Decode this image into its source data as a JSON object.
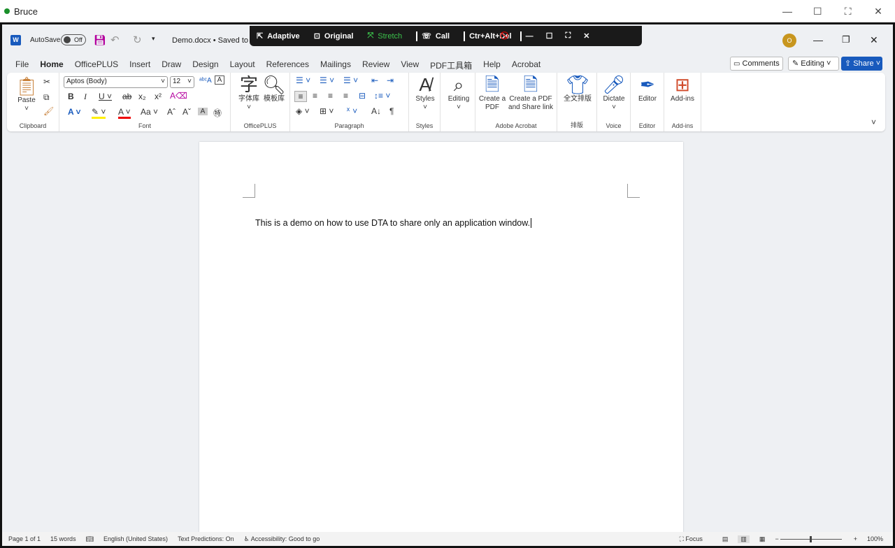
{
  "outer": {
    "user": "Bruce",
    "status_color": "#1a8f2a"
  },
  "toolbar": {
    "adaptive": "Adaptive",
    "original": "Original",
    "stretch": "Stretch",
    "call": "Call",
    "cad": "Ctr+Alt+Del",
    "stretch_color": "#3cc34c"
  },
  "word": {
    "autosave": "AutoSave",
    "autosave_state": "Off",
    "doc_title": "Demo.docx • Saved to t",
    "avatar": "O",
    "tabs": [
      "File",
      "Home",
      "OfficePLUS",
      "Insert",
      "Draw",
      "Design",
      "Layout",
      "References",
      "Mailings",
      "Review",
      "View",
      "PDF工具箱",
      "Help",
      "Acrobat"
    ],
    "comments": "Comments",
    "editing": "Editing",
    "share": "Share",
    "accent": "#185abd"
  },
  "ribbon": {
    "paste": "Paste",
    "font_name": "Aptos (Body)",
    "font_size": "12",
    "groups": [
      "Clipboard",
      "Font",
      "OfficePLUS",
      "Paragraph",
      "Styles",
      "Adobe Acrobat",
      "排版",
      "Voice",
      "Editor",
      "Add-ins"
    ],
    "ziti": "字体库",
    "muban": "模板库",
    "styles": "Styles",
    "editing": "Editing",
    "create_pdf": "Create a PDF",
    "create_share": "Create a PDF and Share link",
    "quanwen": "全文排版",
    "dictate": "Dictate",
    "editor": "Editor",
    "addins": "Add-ins"
  },
  "document": {
    "text": "This is a demo on how to use DTA to share only an application window."
  },
  "status": {
    "page": "Page 1 of 1",
    "words": "15 words",
    "language": "English (United States)",
    "predictions": "Text Predictions: On",
    "accessibility": "Accessibility: Good to go",
    "focus": "Focus",
    "zoom": "100%",
    "zoom_percent": 100
  }
}
